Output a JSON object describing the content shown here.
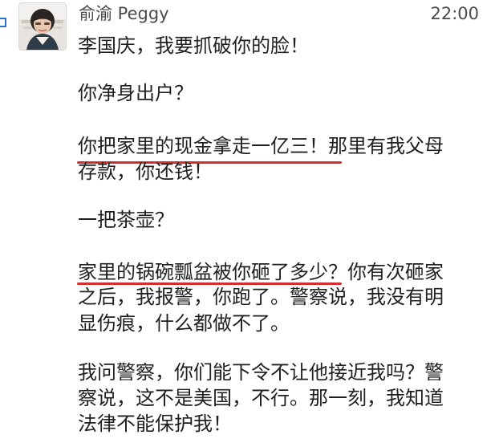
{
  "post": {
    "author": "俞渝 Peggy",
    "time": "22:00",
    "lines": [
      "李国庆，我要抓破你的脸！",
      "你净身出户？",
      "你把家里的现金拿走一亿三！那里有我父母",
      "存款，你还钱！",
      "一把茶壶？",
      "家里的锅碗瓢盆被你砸了多少？你有次砸家",
      "之后，我报警，你跑了。警察说，我没有明",
      "显伤痕，什么都做不了。",
      "我问警察，你们能下令不让他接近我吗？警",
      "察说，这不是美国，不行。那一刻，我知道",
      "法律不能保护我！"
    ]
  },
  "colors": {
    "underline": "#d62e2e",
    "accent": "#2f6fd0"
  }
}
